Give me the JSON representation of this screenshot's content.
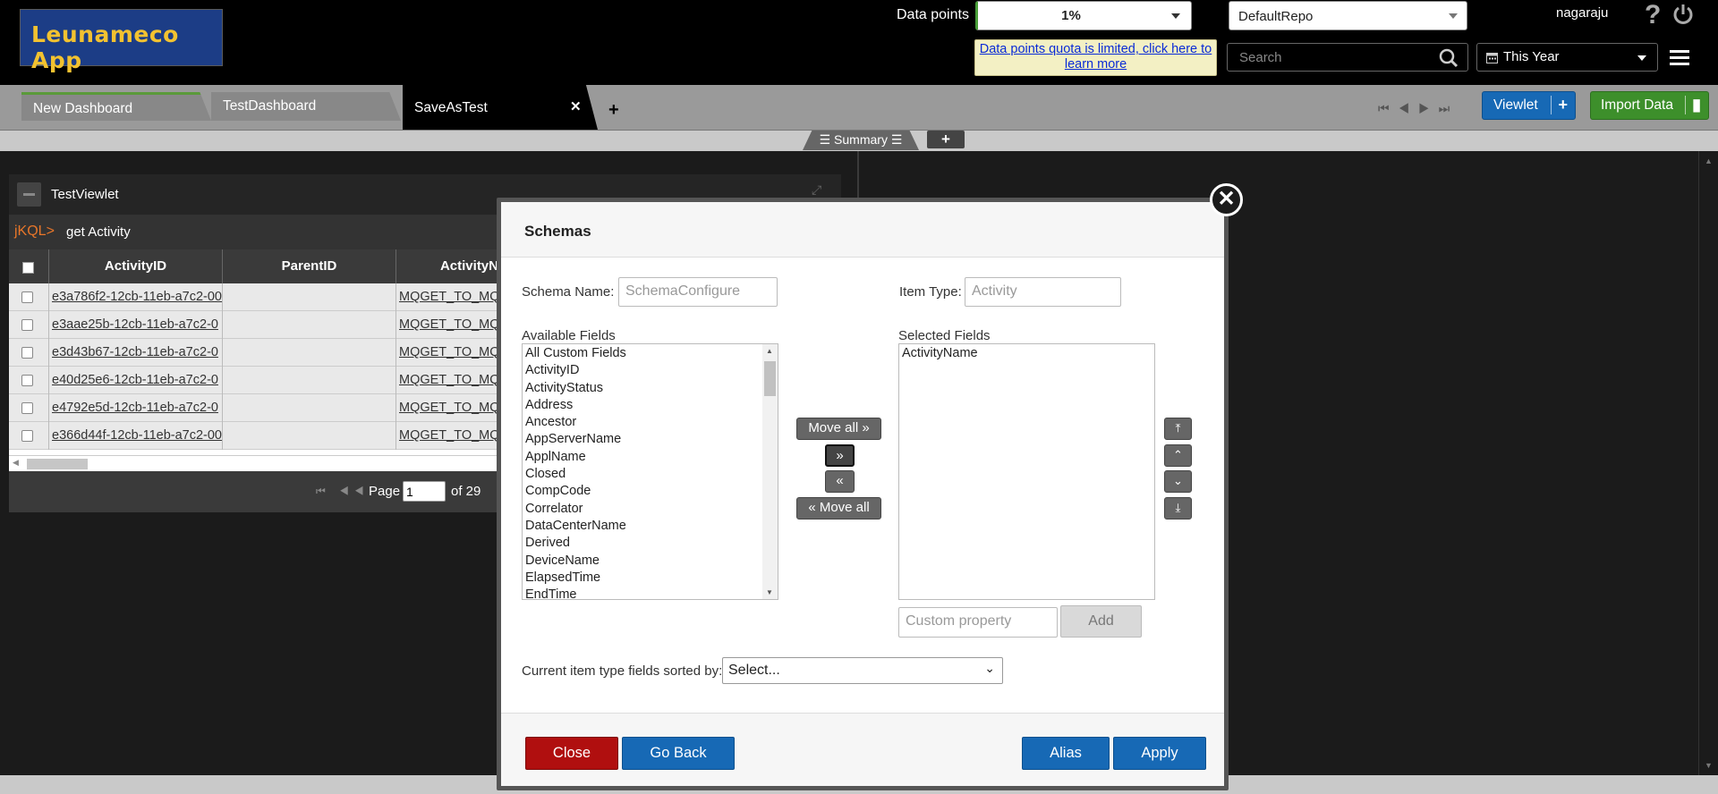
{
  "header": {
    "logo_text": "Leunameco App",
    "data_points_label": "Data points",
    "data_points_value": "1%",
    "repository": "DefaultRepo",
    "user": "nagaraju",
    "quota_link": "Data points quota is limited, click here to learn more",
    "search_placeholder": "Search",
    "period": "This Year",
    "help_icon": "?"
  },
  "tabs": [
    {
      "label": "New Dashboard"
    },
    {
      "label": "TestDashboard"
    },
    {
      "label": "SaveAsTest"
    }
  ],
  "toolbar": {
    "close_tab": "✕",
    "add_tab": "+",
    "viewlet_button": "Viewlet",
    "import_button": "Import Data",
    "summary_tab": "☰ Summary ☰",
    "summary_add": "+"
  },
  "viewlet": {
    "title": "TestViewlet",
    "prompt": "jKQL>",
    "query": "get Activity",
    "columns": [
      "ActivityID",
      "ParentID",
      "ActivityName"
    ],
    "rows": [
      {
        "id": "e3a786f2-12cb-11eb-a7c2-00",
        "parent": "",
        "name": "MQGET_TO_MQ"
      },
      {
        "id": "e3aae25b-12cb-11eb-a7c2-0",
        "parent": "",
        "name": "MQGET_TO_MQ"
      },
      {
        "id": "e3d43b67-12cb-11eb-a7c2-0",
        "parent": "",
        "name": "MQGET_TO_MQ"
      },
      {
        "id": "e40d25e6-12cb-11eb-a7c2-0",
        "parent": "",
        "name": "MQGET_TO_MQ"
      },
      {
        "id": "e4792e5d-12cb-11eb-a7c2-0",
        "parent": "",
        "name": "MQGET_TO_MQ"
      },
      {
        "id": "e366d44f-12cb-11eb-a7c2-00",
        "parent": "",
        "name": "MQGET_TO_MQ"
      }
    ],
    "pager": {
      "page_label": "Page",
      "page": "1",
      "of_label": "of 29"
    }
  },
  "modal": {
    "title": "Schemas",
    "close_icon": "✕",
    "schema_name_label": "Schema Name:",
    "schema_name_value": "SchemaConfigure",
    "item_type_label": "Item Type:",
    "item_type_value": "Activity",
    "available_label": "Available Fields",
    "available_fields": [
      "All Custom Fields",
      "ActivityID",
      "ActivityStatus",
      "Address",
      "Ancestor",
      "AppServerName",
      "ApplName",
      "Closed",
      "CompCode",
      "Correlator",
      "DataCenterName",
      "Derived",
      "DeviceName",
      "ElapsedTime",
      "EndTime"
    ],
    "selected_label": "Selected Fields",
    "selected_fields": [
      "ActivityName"
    ],
    "move_all_right": "Move all »",
    "move_right": "»",
    "move_left": "«",
    "move_all_left": "« Move all",
    "order_buttons": [
      "⤒",
      "⌃",
      "⌄",
      "⤓"
    ],
    "custom_property_placeholder": "Custom property",
    "add_button": "Add",
    "sort_label": "Current item type fields sorted by:",
    "sort_value": "Select...",
    "buttons": {
      "close": "Close",
      "go_back": "Go Back",
      "alias": "Alias",
      "apply": "Apply"
    }
  }
}
